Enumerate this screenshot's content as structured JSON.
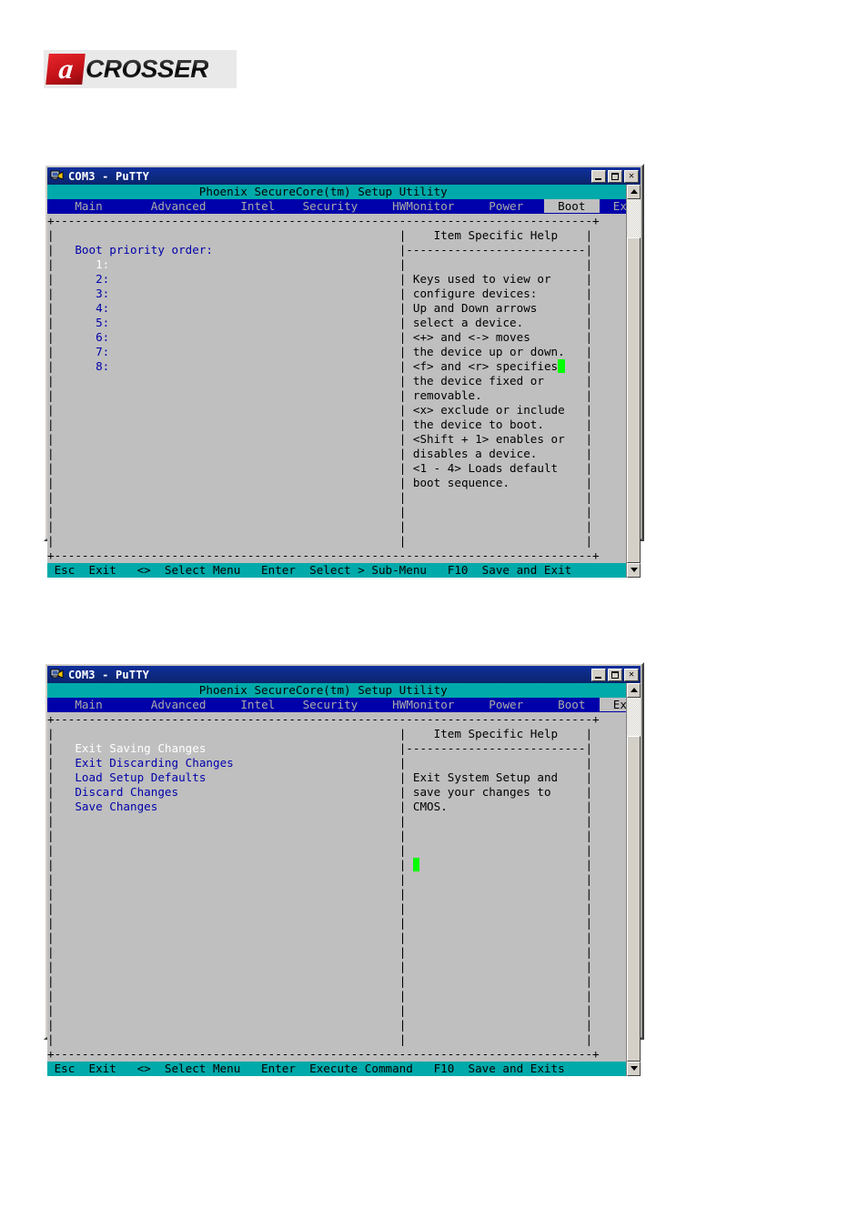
{
  "brand": {
    "logo_mark": "a",
    "logo_text": "CROSSER"
  },
  "windows": [
    {
      "id": "boot-window",
      "title": "COM3 - PuTTY",
      "icon": "putty-terminal-icon",
      "bios_title": "Phoenix SecureCore(tm) Setup Utility",
      "menu": [
        {
          "label": "Main",
          "active": false
        },
        {
          "label": "Advanced",
          "active": false
        },
        {
          "label": "Intel",
          "active": false
        },
        {
          "label": "Security",
          "active": false
        },
        {
          "label": "HWMonitor",
          "active": false
        },
        {
          "label": "Power",
          "active": false
        },
        {
          "label": "Boot",
          "active": true
        },
        {
          "label": "Exit",
          "active": false
        }
      ],
      "left_panel": {
        "heading": "Boot priority order:",
        "items": [
          {
            "label": "1:",
            "selected": true
          },
          {
            "label": "2:",
            "selected": false
          },
          {
            "label": "3:",
            "selected": false
          },
          {
            "label": "4:",
            "selected": false
          },
          {
            "label": "5:",
            "selected": false
          },
          {
            "label": "6:",
            "selected": false
          },
          {
            "label": "7:",
            "selected": false
          },
          {
            "label": "8:",
            "selected": false
          }
        ]
      },
      "help_panel": {
        "heading": "Item Specific Help",
        "lines": [
          "",
          "Keys used to view or",
          "configure devices:",
          "Up and Down arrows",
          "select a device.",
          "<+> and <-> moves",
          "the device up or down.",
          "<f> and <r> specifies",
          "the device fixed or",
          "removable.",
          "<x> exclude or include",
          "the device to boot.",
          "<Shift + 1> enables or",
          "disables a device.",
          "<1 - 4> Loads default",
          "boot sequence.",
          ""
        ],
        "cursor_line_index": 7,
        "cursor_color": "#00ff00"
      },
      "statusbar": [
        {
          "key": "Esc",
          "action": "Exit"
        },
        {
          "key": "<>",
          "action": "Select Menu"
        },
        {
          "key": "Enter",
          "action": "Select > Sub-Menu"
        },
        {
          "key": "F10",
          "action": "Save and Exit"
        }
      ],
      "window_buttons": [
        "minimize",
        "maximize",
        "close"
      ]
    },
    {
      "id": "exit-window",
      "title": "COM3 - PuTTY",
      "icon": "putty-terminal-icon",
      "bios_title": "Phoenix SecureCore(tm) Setup Utility",
      "menu": [
        {
          "label": "Main",
          "active": false
        },
        {
          "label": "Advanced",
          "active": false
        },
        {
          "label": "Intel",
          "active": false
        },
        {
          "label": "Security",
          "active": false
        },
        {
          "label": "HWMonitor",
          "active": false
        },
        {
          "label": "Power",
          "active": false
        },
        {
          "label": "Boot",
          "active": false
        },
        {
          "label": "Exit",
          "active": true
        }
      ],
      "left_panel": {
        "heading": "",
        "items": [
          {
            "label": "Exit Saving Changes",
            "selected": true
          },
          {
            "label": "Exit Discarding Changes",
            "selected": false
          },
          {
            "label": "Load Setup Defaults",
            "selected": false
          },
          {
            "label": "Discard Changes",
            "selected": false
          },
          {
            "label": "Save Changes",
            "selected": false
          }
        ]
      },
      "help_panel": {
        "heading": "Item Specific Help",
        "lines": [
          "",
          "Exit System Setup and",
          "save your changes to",
          "CMOS.",
          "",
          "",
          "",
          "",
          "",
          "",
          "",
          "",
          "",
          "",
          "",
          "",
          ""
        ],
        "cursor_line_index": 7,
        "cursor_color": "#00ff00"
      },
      "statusbar": [
        {
          "key": "Esc",
          "action": "Exit"
        },
        {
          "key": "<>",
          "action": "Select Menu"
        },
        {
          "key": "Enter",
          "action": "Execute Command"
        },
        {
          "key": "F10",
          "action": "Save and Exits"
        }
      ],
      "window_buttons": [
        "minimize",
        "maximize",
        "close"
      ]
    }
  ],
  "colors": {
    "bios_title_bg": "#00aaaa",
    "menu_bg": "#0000aa",
    "menu_fg": "#aaaaaa",
    "terminal_bg": "#bfbfbf",
    "text_blue": "#0000aa",
    "text_white": "#ffffff",
    "cursor_green": "#00ff00",
    "titlebar_bg": "#0a246a",
    "chrome_gray": "#d4d0c8"
  }
}
